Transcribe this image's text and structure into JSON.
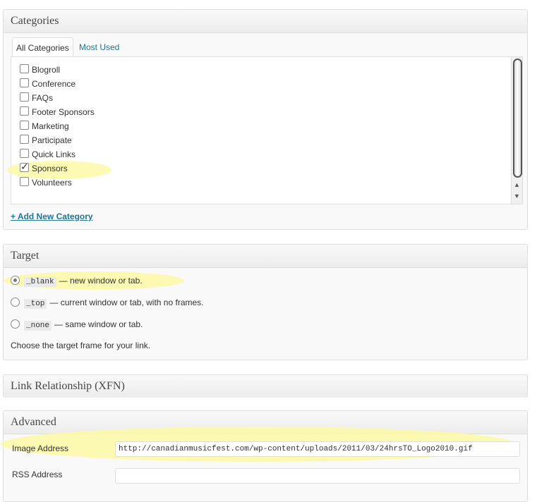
{
  "categories_box": {
    "title": "Categories",
    "tabs": [
      {
        "label": "All Categories",
        "active": true
      },
      {
        "label": "Most Used",
        "active": false
      }
    ],
    "items": [
      {
        "label": "Blogroll",
        "checked": false
      },
      {
        "label": "Conference",
        "checked": false
      },
      {
        "label": "FAQs",
        "checked": false
      },
      {
        "label": "Footer Sponsors",
        "checked": false
      },
      {
        "label": "Marketing",
        "checked": false
      },
      {
        "label": "Participate",
        "checked": false
      },
      {
        "label": "Quick Links",
        "checked": false
      },
      {
        "label": "Sponsors",
        "checked": true
      },
      {
        "label": "Volunteers",
        "checked": false
      }
    ],
    "add_link": "+ Add New Category"
  },
  "target_box": {
    "title": "Target",
    "options": [
      {
        "code": "_blank",
        "desc": "— new window or tab.",
        "selected": true
      },
      {
        "code": "_top",
        "desc": "— current window or tab, with no frames.",
        "selected": false
      },
      {
        "code": "_none",
        "desc": "— same window or tab.",
        "selected": false
      }
    ],
    "description": "Choose the target frame for your link."
  },
  "xfn_box": {
    "title": "Link Relationship (XFN)"
  },
  "advanced_box": {
    "title": "Advanced",
    "image_address_label": "Image Address",
    "image_address_value": "http://canadianmusicfest.com/wp-content/uploads/2011/03/24hrsTO_Logo2010.gif",
    "rss_address_label": "RSS Address",
    "rss_address_value": ""
  },
  "colors": {
    "link": "#21759b",
    "highlight": "#fbf9a6"
  }
}
